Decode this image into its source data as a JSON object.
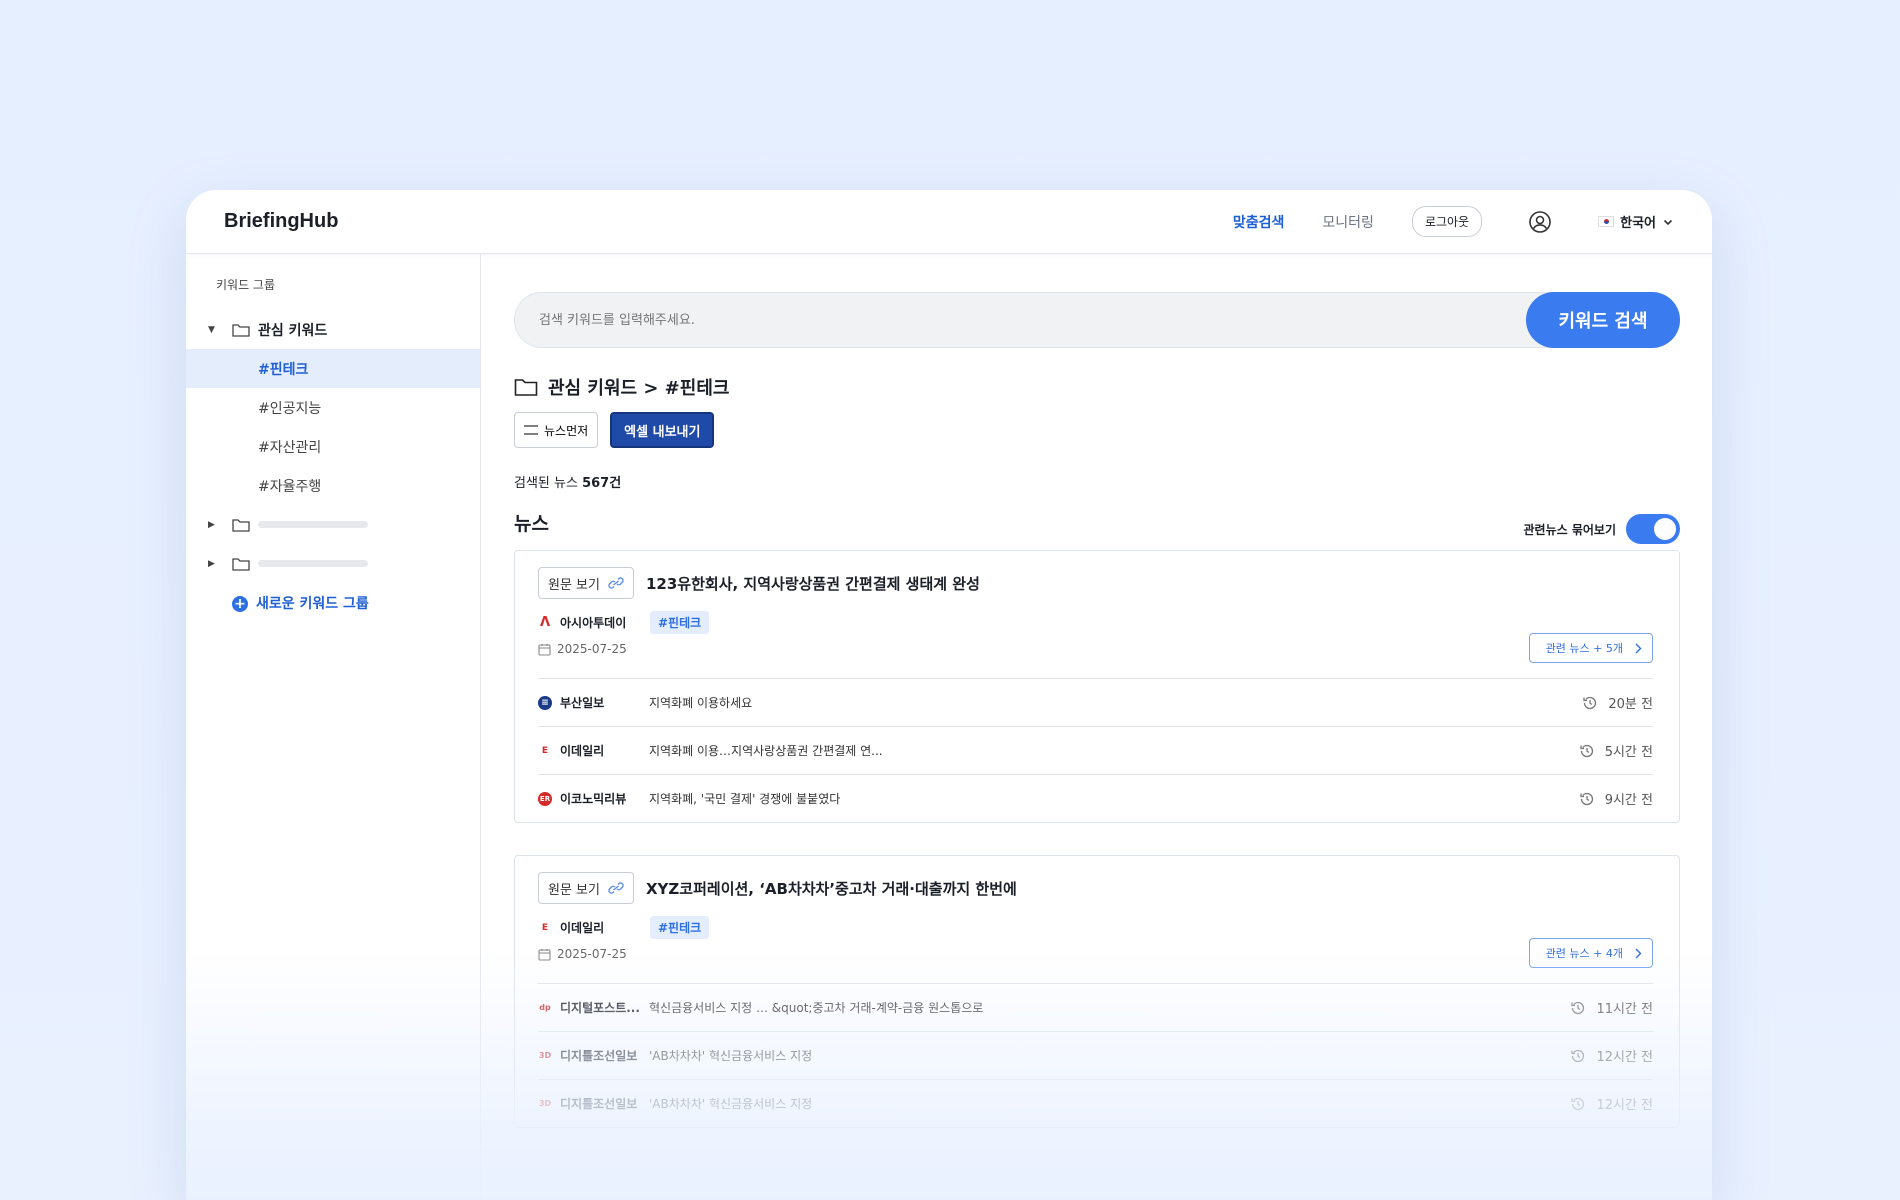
{
  "app": {
    "title": "BriefingHub"
  },
  "nav": {
    "search_label": "맞춤검색",
    "monitoring_label": "모니터링",
    "logout_label": "로그아웃",
    "language_label": "한국어"
  },
  "sidebar": {
    "title": "키워드 그룹",
    "group_name": "관심 키워드",
    "keywords": [
      "#핀테크",
      "#인공지능",
      "#자산관리",
      "#자율주행"
    ],
    "selected_keyword": "#핀테크",
    "new_group_label": "새로운 키워드 그룹"
  },
  "search": {
    "placeholder": "검색 키워드를 입력해주세요.",
    "button_label": "키워드 검색"
  },
  "breadcrumb": "관심 키워드 > #핀테크",
  "actions": {
    "sort_label": "뉴스먼저",
    "export_label": "엑셀 내보내기"
  },
  "result_count": {
    "prefix": "검색된 뉴스 ",
    "count": "567건"
  },
  "news_section": {
    "title": "뉴스",
    "group_toggle_label": "관련뉴스 묶어보기",
    "group_toggle_on": true
  },
  "colors": {
    "accent": "#3a7bf0",
    "dark_button": "#1f4aa8",
    "selected_bg": "#e3edfc"
  },
  "news": [
    {
      "original_label": "원문 보기",
      "headline": "123유한회사, 지역사랑상품권 간편결제 생태계 완성",
      "source": "아시아투데이",
      "tag": "#핀테크",
      "date": "2025-07-25",
      "related_label": "관련 뉴스 + 5개",
      "related": [
        {
          "source": "부산일보",
          "text": "지역화폐 이용하세요",
          "time": "20분 전"
        },
        {
          "source": "이데일리",
          "text": "지역화폐 이용…지역사랑상품권 간편결제 연...",
          "time": "5시간 전"
        },
        {
          "source": "이코노믹리뷰",
          "text": "지역화폐, '국민 결제' 경쟁에 불붙였다",
          "time": "9시간 전"
        }
      ]
    },
    {
      "original_label": "원문 보기",
      "headline": "XYZ코퍼레이션, ‘AB차차차’중고차 거래·대출까지 한번에",
      "source": "이데일리",
      "tag": "#핀테크",
      "date": "2025-07-25",
      "related_label": "관련 뉴스 + 4개",
      "related": [
        {
          "source": "디지털포스트...",
          "text": "혁신금융서비스 지정 … &quot;중고차 거래-계약-금융 원스톱으로",
          "time": "11시간 전"
        },
        {
          "source": "디지틀조선일보",
          "text": "'AB차차차' 혁신금융서비스 지정",
          "time": "12시간 전"
        },
        {
          "source": "디지틀조선일보",
          "text": "'AB차차차' 혁신금융서비스 지정",
          "time": "12시간 전"
        }
      ]
    }
  ]
}
